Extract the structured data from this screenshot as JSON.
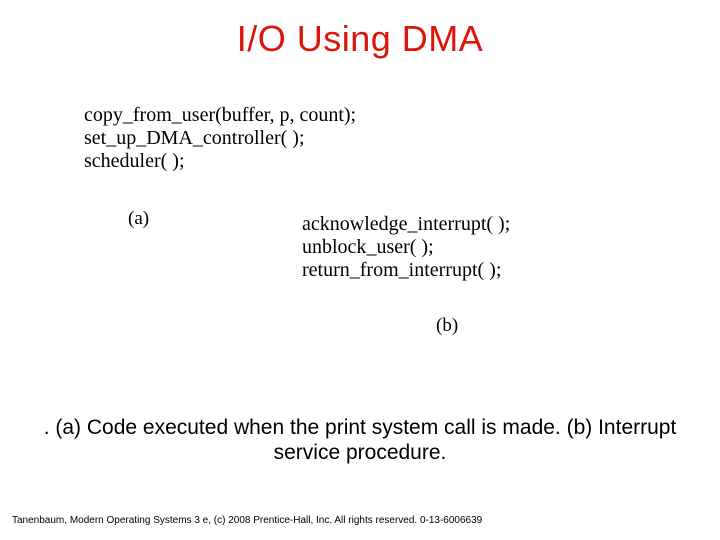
{
  "title": "I/O Using DMA",
  "code_a": {
    "line1_parts": [
      "copy",
      "from",
      "user(buffer, p, count);"
    ],
    "line2_parts": [
      "set",
      "up",
      "DMA",
      "controller( );"
    ],
    "line3": "scheduler( );",
    "label": "(a)"
  },
  "code_b": {
    "line1_parts": [
      "acknowledge",
      "interrupt( );"
    ],
    "line2_parts": [
      "unblock",
      "user( );"
    ],
    "line3_parts": [
      "return",
      "from",
      "interrupt( );"
    ],
    "label": "(b)"
  },
  "caption": ". (a) Code executed when the print system call is made. (b) Interrupt service procedure.",
  "footer": "Tanenbaum, Modern Operating Systems 3 e, (c) 2008 Prentice-Hall, Inc. All rights reserved. 0-13-6006639"
}
